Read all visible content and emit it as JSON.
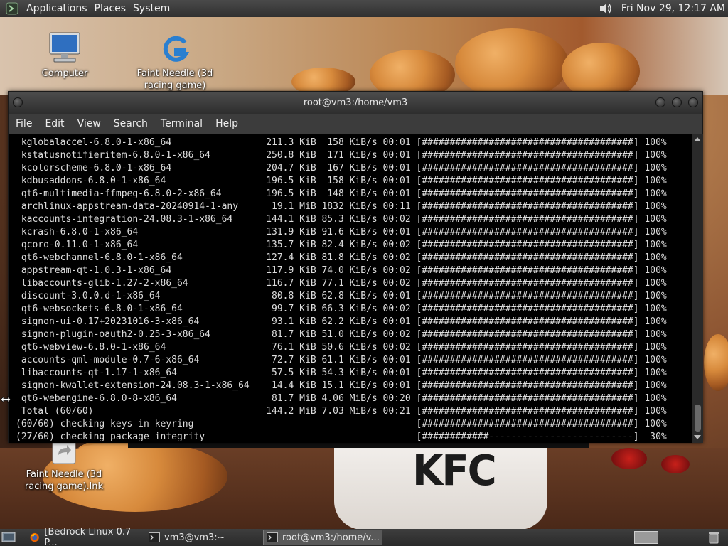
{
  "top_panel": {
    "menus": [
      "Applications",
      "Places",
      "System"
    ],
    "clock": "Fri Nov 29, 12:17 AM"
  },
  "desktop": {
    "icons": [
      {
        "label": "Computer",
        "icon": "computer-icon"
      },
      {
        "label": "Faint Needle (3d racing game)",
        "icon": "game-launcher-icon"
      },
      {
        "label": "Faint Needle (3d racing game).lnk",
        "icon": "shortcut-icon"
      }
    ],
    "wallpaper_brand": "KFC"
  },
  "terminal": {
    "title": "root@vm3:/home/vm3",
    "menubar": [
      "File",
      "Edit",
      "View",
      "Search",
      "Terminal",
      "Help"
    ],
    "downloads": [
      {
        "name": "kglobalaccel-6.8.0-1-x86_64",
        "size": "211.3 KiB",
        "rate": "158 KiB/s",
        "time": "00:01",
        "bar": "[######################################]",
        "pct": "100%"
      },
      {
        "name": "kstatusnotifieritem-6.8.0-1-x86_64",
        "size": "250.8 KiB",
        "rate": "171 KiB/s",
        "time": "00:01",
        "bar": "[######################################]",
        "pct": "100%"
      },
      {
        "name": "kcolorscheme-6.8.0-1-x86_64",
        "size": "204.7 KiB",
        "rate": "167 KiB/s",
        "time": "00:01",
        "bar": "[######################################]",
        "pct": "100%"
      },
      {
        "name": "kdbusaddons-6.8.0-1-x86_64",
        "size": "196.5 KiB",
        "rate": "158 KiB/s",
        "time": "00:01",
        "bar": "[######################################]",
        "pct": "100%"
      },
      {
        "name": "qt6-multimedia-ffmpeg-6.8.0-2-x86_64",
        "size": "196.5 KiB",
        "rate": "148 KiB/s",
        "time": "00:01",
        "bar": "[######################################]",
        "pct": "100%"
      },
      {
        "name": "archlinux-appstream-data-20240914-1-any",
        "size": "19.1 MiB",
        "rate": "1832 KiB/s",
        "time": "00:11",
        "bar": "[######################################]",
        "pct": "100%"
      },
      {
        "name": "kaccounts-integration-24.08.3-1-x86_64",
        "size": "144.1 KiB",
        "rate": "85.3 KiB/s",
        "time": "00:02",
        "bar": "[######################################]",
        "pct": "100%"
      },
      {
        "name": "kcrash-6.8.0-1-x86_64",
        "size": "131.9 KiB",
        "rate": "91.6 KiB/s",
        "time": "00:01",
        "bar": "[######################################]",
        "pct": "100%"
      },
      {
        "name": "qcoro-0.11.0-1-x86_64",
        "size": "135.7 KiB",
        "rate": "82.4 KiB/s",
        "time": "00:02",
        "bar": "[######################################]",
        "pct": "100%"
      },
      {
        "name": "qt6-webchannel-6.8.0-1-x86_64",
        "size": "127.4 KiB",
        "rate": "81.8 KiB/s",
        "time": "00:02",
        "bar": "[######################################]",
        "pct": "100%"
      },
      {
        "name": "appstream-qt-1.0.3-1-x86_64",
        "size": "117.9 KiB",
        "rate": "74.0 KiB/s",
        "time": "00:02",
        "bar": "[######################################]",
        "pct": "100%"
      },
      {
        "name": "libaccounts-glib-1.27-2-x86_64",
        "size": "116.7 KiB",
        "rate": "77.1 KiB/s",
        "time": "00:02",
        "bar": "[######################################]",
        "pct": "100%"
      },
      {
        "name": "discount-3.0.0.d-1-x86_64",
        "size": "80.8 KiB",
        "rate": "62.8 KiB/s",
        "time": "00:01",
        "bar": "[######################################]",
        "pct": "100%"
      },
      {
        "name": "qt6-websockets-6.8.0-1-x86_64",
        "size": "99.7 KiB",
        "rate": "66.3 KiB/s",
        "time": "00:02",
        "bar": "[######################################]",
        "pct": "100%"
      },
      {
        "name": "signon-ui-0.17+20231016-3-x86_64",
        "size": "93.1 KiB",
        "rate": "62.2 KiB/s",
        "time": "00:01",
        "bar": "[######################################]",
        "pct": "100%"
      },
      {
        "name": "signon-plugin-oauth2-0.25-3-x86_64",
        "size": "81.7 KiB",
        "rate": "51.0 KiB/s",
        "time": "00:02",
        "bar": "[######################################]",
        "pct": "100%"
      },
      {
        "name": "qt6-webview-6.8.0-1-x86_64",
        "size": "76.1 KiB",
        "rate": "50.6 KiB/s",
        "time": "00:02",
        "bar": "[######################################]",
        "pct": "100%"
      },
      {
        "name": "accounts-qml-module-0.7-6-x86_64",
        "size": "72.7 KiB",
        "rate": "61.1 KiB/s",
        "time": "00:01",
        "bar": "[######################################]",
        "pct": "100%"
      },
      {
        "name": "libaccounts-qt-1.17-1-x86_64",
        "size": "57.5 KiB",
        "rate": "54.3 KiB/s",
        "time": "00:01",
        "bar": "[######################################]",
        "pct": "100%"
      },
      {
        "name": "signon-kwallet-extension-24.08.3-1-x86_64",
        "size": "14.4 KiB",
        "rate": "15.1 KiB/s",
        "time": "00:01",
        "bar": "[######################################]",
        "pct": "100%"
      },
      {
        "name": "qt6-webengine-6.8.0-8-x86_64",
        "size": "81.7 MiB",
        "rate": "4.06 MiB/s",
        "time": "00:20",
        "bar": "[######################################]",
        "pct": "100%"
      },
      {
        "name": "Total (60/60)",
        "size": "144.2 MiB",
        "rate": "7.03 MiB/s",
        "time": "00:21",
        "bar": "[######################################]",
        "pct": "100%"
      }
    ],
    "status_lines": [
      {
        "text": "(60/60) checking keys in keyring",
        "bar": "[######################################]",
        "pct": "100%"
      },
      {
        "text": "(27/60) checking package integrity",
        "bar": "[############--------------------------]",
        "pct": "30%"
      }
    ]
  },
  "taskbar": {
    "tasks": [
      {
        "label": "[Bedrock Linux 0.7 P...",
        "icon": "firefox-icon"
      },
      {
        "label": "vm3@vm3:~",
        "icon": "terminal-icon"
      },
      {
        "label": "root@vm3:/home/v...",
        "icon": "terminal-icon"
      }
    ]
  },
  "colors": {
    "panel_bg": "#303030",
    "terminal_bg": "#000000",
    "terminal_fg": "#dcdcdc"
  }
}
